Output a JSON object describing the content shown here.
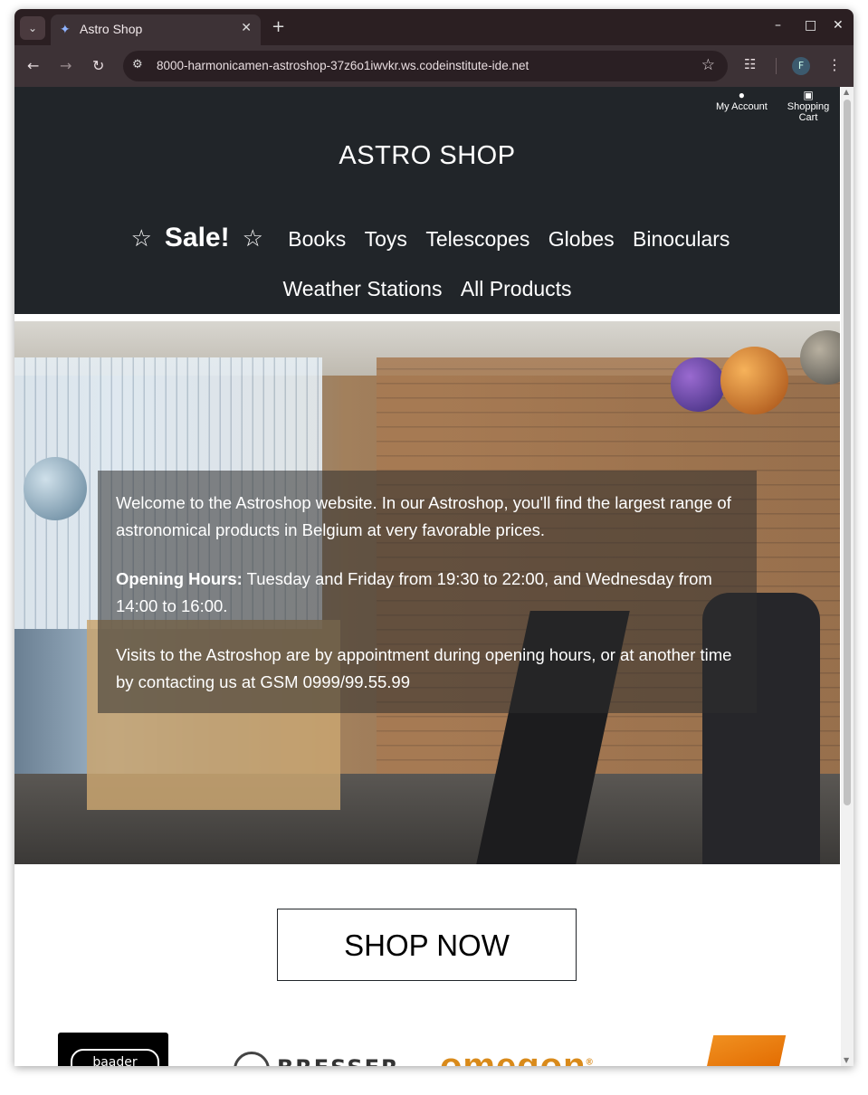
{
  "browser": {
    "tab_title": "Astro Shop",
    "url": "8000-harmonicamen-astroshop-37z6o1iwvkr.ws.codeinstitute-ide.net",
    "profile_initial": "F"
  },
  "site": {
    "utility": {
      "account_label": "My Account",
      "cart_label": "Shopping Cart"
    },
    "logo": "ASTRO SHOP",
    "nav": {
      "sale": "Sale!",
      "items": [
        "Books",
        "Toys",
        "Telescopes",
        "Globes",
        "Binoculars",
        "Weather Stations",
        "All Products"
      ]
    },
    "hero": {
      "welcome": "Welcome to the Astroshop website. In our Astroshop, you'll find the largest range of astronomical products in Belgium at very favorable prices.",
      "hours_label": "Opening Hours:",
      "hours_text": " Tuesday and Friday from 19:30 to 22:00, and Wednesday from 14:00 to 16:00.",
      "visits": "Visits to the Astroshop are by appointment during opening hours, or at another time by contacting us at GSM 0999/99.55.99"
    },
    "cta": "SHOP NOW",
    "brands": {
      "baader": "baader",
      "bresser": "BRESSER",
      "omegon": "omegon"
    }
  },
  "colors": {
    "header_bg": "#212529",
    "tab_bar_bg": "#2b1f22",
    "omegon_orange": "#d98a1a"
  },
  "icons": [
    "chevron-down-icon",
    "telescope-favicon-icon",
    "close-icon",
    "plus-icon",
    "minimize-icon",
    "maximize-icon",
    "back-icon",
    "forward-icon",
    "reload-icon",
    "site-info-icon",
    "bookmark-star-icon",
    "extensions-icon",
    "kebab-menu-icon",
    "user-icon",
    "cart-icon",
    "star-outline-icon"
  ]
}
